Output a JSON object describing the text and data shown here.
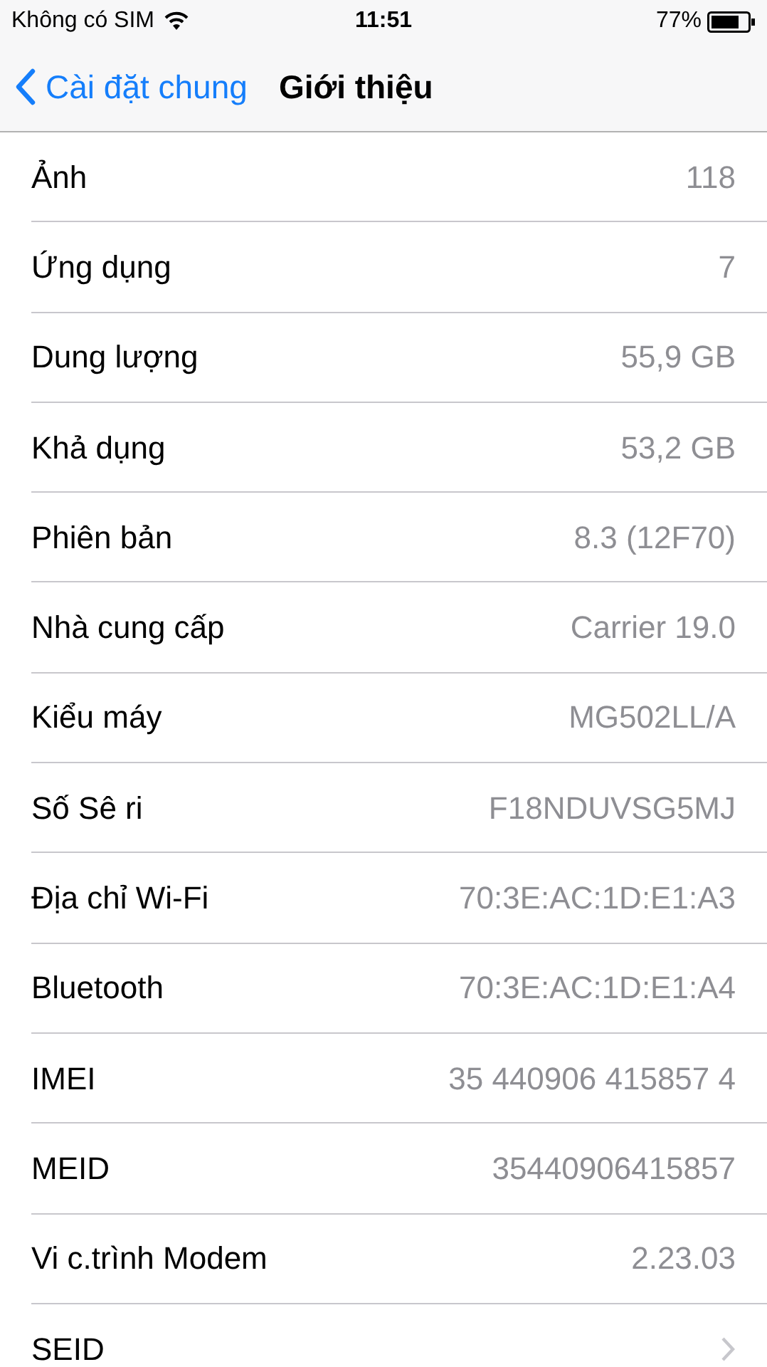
{
  "status_bar": {
    "carrier": "Không có SIM",
    "time": "11:51",
    "battery": "77%"
  },
  "nav": {
    "back_label": "Cài đặt chung",
    "title": "Giới thiệu"
  },
  "rows": [
    {
      "label": "Ảnh",
      "value": "118",
      "kind": "value"
    },
    {
      "label": "Ứng dụng",
      "value": "7",
      "kind": "value"
    },
    {
      "label": "Dung lượng",
      "value": "55,9 GB",
      "kind": "value"
    },
    {
      "label": "Khả dụng",
      "value": "53,2 GB",
      "kind": "value"
    },
    {
      "label": "Phiên bản",
      "value": "8.3 (12F70)",
      "kind": "value"
    },
    {
      "label": "Nhà cung cấp",
      "value": "Carrier 19.0",
      "kind": "value"
    },
    {
      "label": "Kiểu máy",
      "value": "MG502LL/A",
      "kind": "value"
    },
    {
      "label": "Số Sê ri",
      "value": "F18NDUVSG5MJ",
      "kind": "value"
    },
    {
      "label": "Địa chỉ Wi-Fi",
      "value": "70:3E:AC:1D:E1:A3",
      "kind": "value"
    },
    {
      "label": "Bluetooth",
      "value": "70:3E:AC:1D:E1:A4",
      "kind": "value"
    },
    {
      "label": "IMEI",
      "value": "35 440906 415857 4",
      "kind": "value"
    },
    {
      "label": "MEID",
      "value": "35440906415857",
      "kind": "value"
    },
    {
      "label": "Vi c.trình Modem",
      "value": "2.23.03",
      "kind": "value"
    },
    {
      "label": "SEID",
      "kind": "disclosure"
    }
  ]
}
